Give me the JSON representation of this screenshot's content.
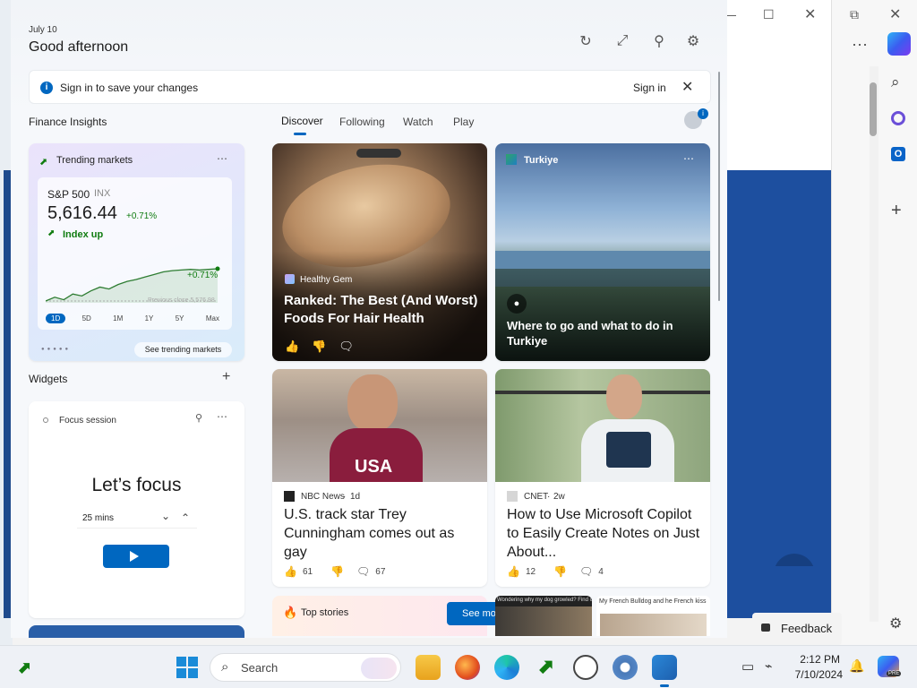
{
  "board": {
    "date": "July 10",
    "greeting": "Good afternoon",
    "banner": {
      "text": "Sign in to save your changes",
      "action": "Sign in"
    },
    "finance_label": "Finance Insights",
    "widgets_label": "Widgets",
    "tabs": [
      {
        "label": "Discover",
        "selected": true
      },
      {
        "label": "Following",
        "selected": false
      },
      {
        "label": "Watch",
        "selected": false
      },
      {
        "label": "Play",
        "selected": false
      }
    ],
    "notification_badge": "i"
  },
  "markets": {
    "header": "Trending markets",
    "name": "S&P 500",
    "ticker": "INX",
    "value": "5,616.44",
    "change": "+0.71%",
    "status": "Index up",
    "chart_label": "+0.71%",
    "prev_close": "Previous close 5,576.98",
    "ranges": [
      "1D",
      "5D",
      "1M",
      "1Y",
      "5Y",
      "Max"
    ],
    "selected_range": "1D",
    "link": "See trending markets",
    "spark": [
      3,
      3.6,
      3.2,
      4.1,
      3.8,
      4.6,
      5.2,
      4.9,
      5.6,
      6.1,
      6.4,
      6.8,
      7.2,
      7.6,
      7.8,
      7.9,
      8.0,
      7.9,
      8.0,
      8.1
    ]
  },
  "focus": {
    "header": "Focus session",
    "title": "Let’s focus",
    "duration": "25 mins"
  },
  "news": [
    {
      "source": "Healthy Gem",
      "title": "Ranked: The Best (And Worst) Foods For Hair Health"
    },
    {
      "source": "Turkiye",
      "title": "Where to go and what to do in Turkiye"
    },
    {
      "source": "NBC News",
      "age": "1d",
      "title": "U.S. track star Trey Cunningham comes out as gay",
      "likes": "61",
      "comments": "67",
      "jersey": "USA"
    },
    {
      "source": "CNET",
      "age": "2w",
      "title": "How to Use Microsoft Copilot to Easily Create Notes on Just About...",
      "likes": "12",
      "comments": "4"
    }
  ],
  "top_stories": {
    "label": "Top stories",
    "button": "See more"
  },
  "mini_stories": [
    "Wondering why my dog growled? Find out before it's a problem. Then found",
    "My French Bulldog and he French kiss"
  ],
  "feedback": "Feedback",
  "taskbar": {
    "search_placeholder": "Search",
    "time": "2:12 PM",
    "date": "7/10/2024",
    "copilot_badge": "PRE"
  },
  "colors": {
    "accent": "#0067c0",
    "positive": "#107c10",
    "blue_bg": "#1d4f9f"
  }
}
